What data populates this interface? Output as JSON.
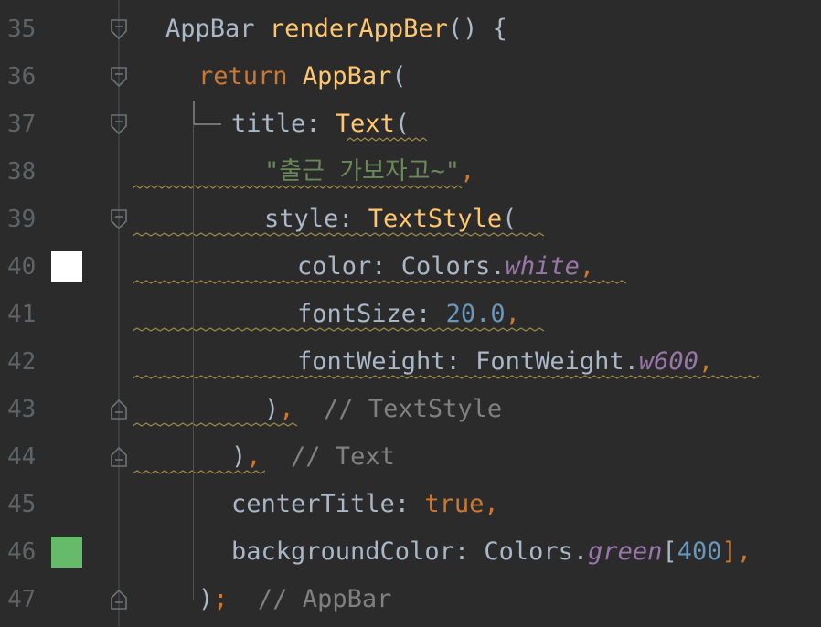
{
  "editor": {
    "colors": {
      "background": "#2b2b2b",
      "keyword": "#cc7832",
      "function": "#ffc66d",
      "string": "#6a8759",
      "number": "#6897bb",
      "property": "#9876aa",
      "comment": "#808080",
      "text": "#a9b7c6",
      "line_number": "#606366",
      "swatch_white": "#ffffff",
      "swatch_green": "#66bb6a"
    },
    "lines": [
      {
        "num": "35",
        "t": {
          "a": "AppBar",
          "b": " ",
          "c": "renderAppBer",
          "d": "() {"
        }
      },
      {
        "num": "36",
        "t": {
          "a": "return",
          "b": " ",
          "c": "AppBar",
          "d": "("
        }
      },
      {
        "num": "37",
        "t": {
          "a": "title: ",
          "b": "Text",
          "c": "("
        }
      },
      {
        "num": "38",
        "t": {
          "a": "\"출근 가보자고~\"",
          "b": ","
        }
      },
      {
        "num": "39",
        "t": {
          "a": "style: ",
          "b": "TextStyle",
          "c": "("
        }
      },
      {
        "num": "40",
        "t": {
          "a": "color: Colors.",
          "b": "white",
          "c": ","
        }
      },
      {
        "num": "41",
        "t": {
          "a": "fontSize: ",
          "b": "20.0",
          "c": ","
        }
      },
      {
        "num": "42",
        "t": {
          "a": "fontWeight: FontWeight.",
          "b": "w600",
          "c": ","
        }
      },
      {
        "num": "43",
        "t": {
          "a": ")",
          "b": ",",
          "c": "  // TextStyle"
        }
      },
      {
        "num": "44",
        "t": {
          "a": ")",
          "b": ",",
          "c": "  // Text"
        }
      },
      {
        "num": "45",
        "t": {
          "a": "centerTitle: ",
          "b": "true",
          "c": ","
        }
      },
      {
        "num": "46",
        "t": {
          "a": "backgroundColor: Colors.",
          "b": "green",
          "c": "[",
          "d": "400",
          "e": "],"
        }
      },
      {
        "num": "47",
        "t": {
          "a": ")",
          "b": ";",
          "c": "  // AppBar"
        }
      }
    ],
    "icons": {
      "fold_open": "fold-open-icon",
      "fold_close": "fold-close-icon"
    }
  }
}
